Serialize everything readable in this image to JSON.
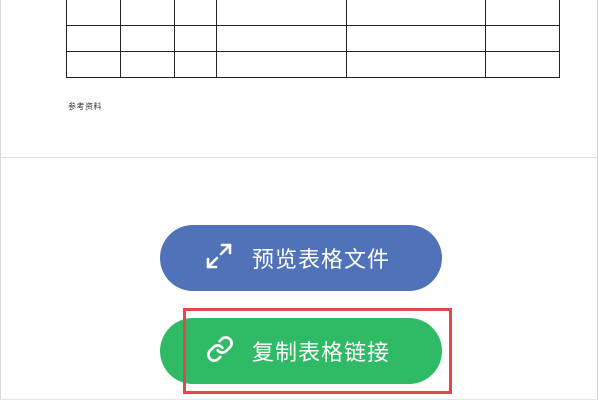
{
  "document": {
    "table_rows": [
      [
        "",
        "",
        "",
        "",
        "",
        ""
      ],
      [
        "",
        "",
        "",
        "",
        "",
        ""
      ],
      [
        "",
        "",
        "",
        "",
        "",
        ""
      ]
    ],
    "reference_label": "参考资料"
  },
  "actions": {
    "preview_label": "预览表格文件",
    "preview_icon": "expand-arrows-icon",
    "copy_label": "复制表格链接",
    "copy_icon": "link-icon"
  },
  "colors": {
    "preview_button": "#4f72b9",
    "copy_button": "#2fba66",
    "highlight": "#e0484b"
  }
}
